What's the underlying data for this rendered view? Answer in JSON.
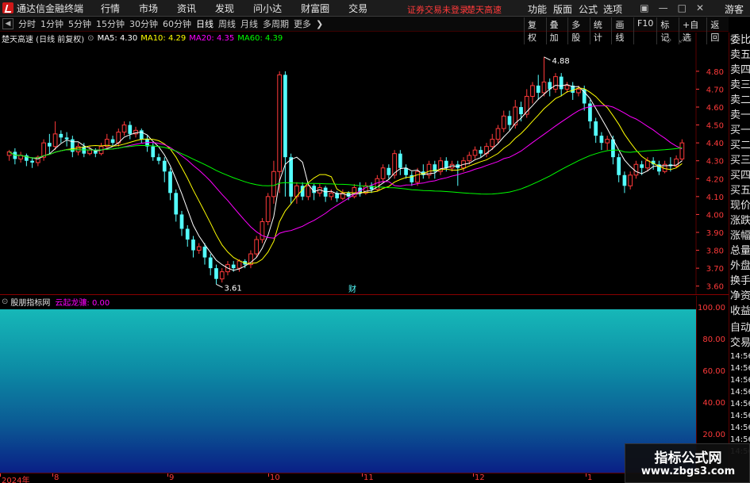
{
  "menubar": {
    "app_title": "通达信金融终端",
    "items": [
      "行情",
      "市场",
      "资讯",
      "发现",
      "问小达",
      "财富圈",
      "交易"
    ],
    "status_warning": "证券交易未登录",
    "status_stock": "楚天高速",
    "right_items": [
      "功能",
      "版面",
      "公式",
      "选项"
    ],
    "guest": "游客"
  },
  "toolbar": {
    "periods": [
      "分时",
      "1分钟",
      "5分钟",
      "15分钟",
      "30分钟",
      "60分钟",
      "日线",
      "周线",
      "月线",
      "多周期",
      "更多"
    ],
    "active_period": "日线",
    "right_buttons": [
      "复权",
      "叠加",
      "多股",
      "统计",
      "画线",
      "F10",
      "标记",
      "+自选",
      "返回"
    ]
  },
  "chart_head": {
    "stock": "楚天高速 (日线 前复权)",
    "ma": [
      {
        "label": "MA5: 4.30",
        "color": "#ffffff"
      },
      {
        "label": "MA10: 4.29",
        "color": "#ffff00"
      },
      {
        "label": "MA20: 4.35",
        "color": "#ff00ff"
      },
      {
        "label": "MA60: 4.39",
        "color": "#00ff00"
      }
    ]
  },
  "side_panel": {
    "items": [
      "委比",
      "卖五",
      "卖四",
      "卖三",
      "卖二",
      "卖一",
      "买一",
      "买二",
      "买三",
      "买四",
      "买五",
      "现价",
      "涨跌",
      "涨幅",
      "总量",
      "外盘",
      "换手",
      "净资",
      "收益"
    ],
    "lower": [
      "自动",
      "交易"
    ],
    "times": [
      "14:56",
      "14:56",
      "14:56",
      "14:56",
      "14:56",
      "14:56",
      "14:56",
      "14:56",
      "14:56"
    ]
  },
  "indicator": {
    "name": "股朋指标网",
    "value_label": "云起龙骧: 0.00",
    "yticks": [
      "100.00",
      "80.00",
      "60.00",
      "40.00",
      "20.00"
    ]
  },
  "xaxis": {
    "labels": [
      "2024年",
      "8",
      "9",
      "10",
      "11",
      "12",
      "1"
    ]
  },
  "watermark": {
    "title": "指标公式网",
    "url": "www.zbgs3.com"
  },
  "chart_data": {
    "type": "candlestick",
    "ylim": [
      3.55,
      4.95
    ],
    "yticks": [
      4.8,
      4.7,
      4.6,
      4.5,
      4.4,
      4.3,
      4.2,
      4.1,
      4.0,
      3.9,
      3.8,
      3.7,
      3.6
    ],
    "annotations": [
      {
        "text": "4.88",
        "value": 4.88
      },
      {
        "text": "3.61",
        "value": 3.61
      },
      {
        "text": "财",
        "value": null
      }
    ],
    "candles": [
      [
        4.33,
        4.35,
        4.3,
        4.36
      ],
      [
        4.35,
        4.31,
        4.28,
        4.37
      ],
      [
        4.31,
        4.33,
        4.29,
        4.35
      ],
      [
        4.33,
        4.3,
        4.27,
        4.34
      ],
      [
        4.3,
        4.29,
        4.26,
        4.32
      ],
      [
        4.29,
        4.32,
        4.27,
        4.33
      ],
      [
        4.32,
        4.4,
        4.3,
        4.42
      ],
      [
        4.4,
        4.38,
        4.34,
        4.45
      ],
      [
        4.38,
        4.45,
        4.36,
        4.52
      ],
      [
        4.45,
        4.43,
        4.4,
        4.47
      ],
      [
        4.43,
        4.42,
        4.38,
        4.46
      ],
      [
        4.42,
        4.35,
        4.32,
        4.44
      ],
      [
        4.35,
        4.38,
        4.33,
        4.4
      ],
      [
        4.38,
        4.34,
        4.32,
        4.4
      ],
      [
        4.34,
        4.36,
        4.33,
        4.38
      ],
      [
        4.36,
        4.34,
        4.32,
        4.37
      ],
      [
        4.34,
        4.38,
        4.33,
        4.4
      ],
      [
        4.38,
        4.42,
        4.36,
        4.45
      ],
      [
        4.42,
        4.4,
        4.38,
        4.44
      ],
      [
        4.4,
        4.46,
        4.38,
        4.48
      ],
      [
        4.46,
        4.5,
        4.44,
        4.52
      ],
      [
        4.5,
        4.45,
        4.42,
        4.52
      ],
      [
        4.45,
        4.47,
        4.43,
        4.49
      ],
      [
        4.47,
        4.42,
        4.4,
        4.48
      ],
      [
        4.42,
        4.38,
        4.35,
        4.44
      ],
      [
        4.38,
        4.32,
        4.3,
        4.4
      ],
      [
        4.32,
        4.3,
        4.28,
        4.34
      ],
      [
        4.3,
        4.24,
        4.18,
        4.32
      ],
      [
        4.24,
        4.12,
        4.08,
        4.26
      ],
      [
        4.12,
        4.0,
        3.96,
        4.14
      ],
      [
        4.0,
        3.92,
        3.88,
        4.02
      ],
      [
        3.92,
        3.86,
        3.82,
        3.94
      ],
      [
        3.86,
        3.8,
        3.76,
        3.88
      ],
      [
        3.8,
        3.82,
        3.78,
        3.84
      ],
      [
        3.82,
        3.76,
        3.72,
        3.84
      ],
      [
        3.76,
        3.7,
        3.66,
        3.78
      ],
      [
        3.7,
        3.64,
        3.61,
        3.72
      ],
      [
        3.64,
        3.68,
        3.62,
        3.7
      ],
      [
        3.68,
        3.72,
        3.66,
        3.74
      ],
      [
        3.72,
        3.7,
        3.68,
        3.74
      ],
      [
        3.7,
        3.74,
        3.68,
        3.75
      ],
      [
        3.74,
        3.72,
        3.7,
        3.75
      ],
      [
        3.72,
        3.78,
        3.7,
        3.8
      ],
      [
        3.78,
        3.86,
        3.76,
        3.88
      ],
      [
        3.86,
        3.96,
        3.84,
        3.98
      ],
      [
        3.96,
        4.1,
        3.94,
        4.12
      ],
      [
        4.1,
        4.24,
        4.06,
        4.3
      ],
      [
        4.24,
        4.78,
        4.12,
        4.8
      ],
      [
        4.78,
        4.32,
        4.1,
        4.8
      ],
      [
        4.32,
        4.1,
        4.06,
        4.34
      ],
      [
        4.1,
        4.16,
        4.06,
        4.18
      ],
      [
        4.16,
        4.1,
        4.08,
        4.18
      ],
      [
        4.1,
        4.16,
        4.08,
        4.18
      ],
      [
        4.16,
        4.12,
        4.08,
        4.17
      ],
      [
        4.12,
        4.15,
        4.1,
        4.17
      ],
      [
        4.15,
        4.1,
        4.07,
        4.16
      ],
      [
        4.1,
        4.12,
        4.08,
        4.14
      ],
      [
        4.12,
        4.09,
        4.07,
        4.13
      ],
      [
        4.09,
        4.12,
        4.08,
        4.14
      ],
      [
        4.12,
        4.1,
        4.08,
        4.13
      ],
      [
        4.1,
        4.15,
        4.09,
        4.17
      ],
      [
        4.15,
        4.12,
        4.1,
        4.18
      ],
      [
        4.12,
        4.16,
        4.11,
        4.18
      ],
      [
        4.16,
        4.14,
        4.12,
        4.18
      ],
      [
        4.14,
        4.2,
        4.13,
        4.22
      ],
      [
        4.2,
        4.26,
        4.18,
        4.28
      ],
      [
        4.26,
        4.22,
        4.2,
        4.28
      ],
      [
        4.22,
        4.34,
        4.2,
        4.36
      ],
      [
        4.34,
        4.26,
        4.22,
        4.36
      ],
      [
        4.26,
        4.22,
        4.2,
        4.28
      ],
      [
        4.22,
        4.18,
        4.16,
        4.24
      ],
      [
        4.18,
        4.24,
        4.16,
        4.26
      ],
      [
        4.24,
        4.22,
        4.2,
        4.28
      ],
      [
        4.22,
        4.28,
        4.2,
        4.3
      ],
      [
        4.28,
        4.24,
        4.2,
        4.3
      ],
      [
        4.24,
        4.3,
        4.22,
        4.32
      ],
      [
        4.3,
        4.26,
        4.24,
        4.32
      ],
      [
        4.26,
        4.28,
        4.24,
        4.3
      ],
      [
        4.28,
        4.26,
        4.16,
        4.3
      ],
      [
        4.26,
        4.3,
        4.24,
        4.32
      ],
      [
        4.3,
        4.33,
        4.28,
        4.35
      ],
      [
        4.33,
        4.36,
        4.31,
        4.38
      ],
      [
        4.36,
        4.34,
        4.32,
        4.38
      ],
      [
        4.34,
        4.38,
        4.32,
        4.4
      ],
      [
        4.38,
        4.42,
        4.36,
        4.45
      ],
      [
        4.42,
        4.48,
        4.4,
        4.5
      ],
      [
        4.48,
        4.55,
        4.46,
        4.58
      ],
      [
        4.55,
        4.5,
        4.47,
        4.58
      ],
      [
        4.5,
        4.6,
        4.48,
        4.64
      ],
      [
        4.6,
        4.56,
        4.52,
        4.63
      ],
      [
        4.56,
        4.66,
        4.54,
        4.7
      ],
      [
        4.66,
        4.72,
        4.62,
        4.74
      ],
      [
        4.72,
        4.68,
        4.64,
        4.78
      ],
      [
        4.68,
        4.74,
        4.66,
        4.88
      ],
      [
        4.74,
        4.7,
        4.66,
        4.76
      ],
      [
        4.7,
        4.77,
        4.68,
        4.79
      ],
      [
        4.77,
        4.7,
        4.66,
        4.79
      ],
      [
        4.7,
        4.72,
        4.68,
        4.74
      ],
      [
        4.72,
        4.68,
        4.64,
        4.74
      ],
      [
        4.68,
        4.7,
        4.66,
        4.72
      ],
      [
        4.7,
        4.62,
        4.58,
        4.72
      ],
      [
        4.62,
        4.52,
        4.48,
        4.64
      ],
      [
        4.52,
        4.44,
        4.4,
        4.54
      ],
      [
        4.44,
        4.4,
        4.36,
        4.46
      ],
      [
        4.4,
        4.42,
        4.36,
        4.44
      ],
      [
        4.42,
        4.32,
        4.28,
        4.44
      ],
      [
        4.32,
        4.22,
        4.18,
        4.34
      ],
      [
        4.22,
        4.16,
        4.12,
        4.24
      ],
      [
        4.16,
        4.22,
        4.14,
        4.24
      ],
      [
        4.22,
        4.28,
        4.2,
        4.3
      ],
      [
        4.28,
        4.26,
        4.22,
        4.3
      ],
      [
        4.26,
        4.3,
        4.24,
        4.32
      ],
      [
        4.3,
        4.28,
        4.25,
        4.32
      ],
      [
        4.28,
        4.24,
        4.22,
        4.3
      ],
      [
        4.24,
        4.28,
        4.23,
        4.3
      ],
      [
        4.28,
        4.27,
        4.24,
        4.32
      ],
      [
        4.27,
        4.31,
        4.26,
        4.33
      ],
      [
        4.31,
        4.4,
        4.3,
        4.42
      ]
    ]
  }
}
